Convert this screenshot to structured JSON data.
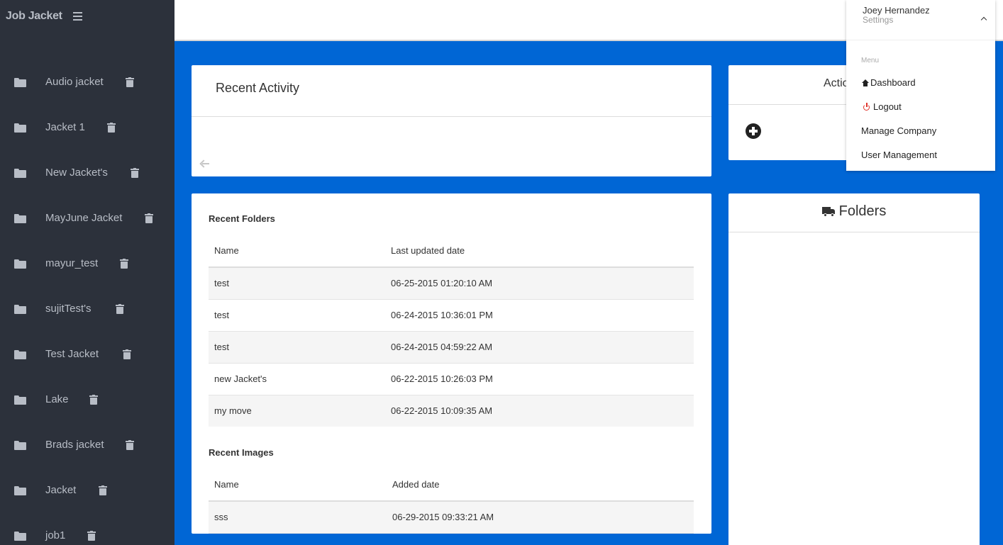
{
  "app": {
    "brand": "Job Jacket"
  },
  "sidebar": {
    "items": [
      {
        "label": "Audio jacket"
      },
      {
        "label": "Jacket 1"
      },
      {
        "label": "New Jacket's"
      },
      {
        "label": "MayJune Jacket"
      },
      {
        "label": "mayur_test"
      },
      {
        "label": "sujitTest's"
      },
      {
        "label": "Test Jacket"
      },
      {
        "label": "Lake"
      },
      {
        "label": "Brads jacket"
      },
      {
        "label": "Jacket"
      },
      {
        "label": "job1"
      }
    ]
  },
  "recent_activity": {
    "title": "Recent Activity"
  },
  "actions": {
    "title": "Actio"
  },
  "recent_folders": {
    "title": "Recent Folders",
    "headers": [
      "Name",
      "Last updated date"
    ],
    "rows": [
      [
        "test",
        "06-25-2015 01:20:10 AM"
      ],
      [
        "test",
        "06-24-2015 10:36:01 PM"
      ],
      [
        "test",
        "06-24-2015 04:59:22 AM"
      ],
      [
        "new Jacket's",
        "06-22-2015 10:26:03 PM"
      ],
      [
        "my move",
        "06-22-2015 10:09:35 AM"
      ]
    ]
  },
  "recent_images": {
    "title": "Recent Images",
    "headers": [
      "Name",
      "Added date"
    ],
    "rows": [
      [
        "sss",
        "06-29-2015 09:33:21 AM"
      ]
    ]
  },
  "folders_panel": {
    "title": "Folders"
  },
  "user_menu": {
    "name": "Joey Hernandez",
    "subtitle": "Settings",
    "menu_label": "Menu",
    "items": [
      {
        "label": "Dashboard",
        "icon": "home-icon"
      },
      {
        "label": "Logout",
        "icon": "power-icon"
      },
      {
        "label": "Manage Company"
      },
      {
        "label": "User Management"
      }
    ]
  },
  "colors": {
    "sidebar": "#2c313b",
    "main_bg": "#0066d5",
    "sidebar_text": "#b8bdc6",
    "logout_icon": "#e0342b"
  }
}
